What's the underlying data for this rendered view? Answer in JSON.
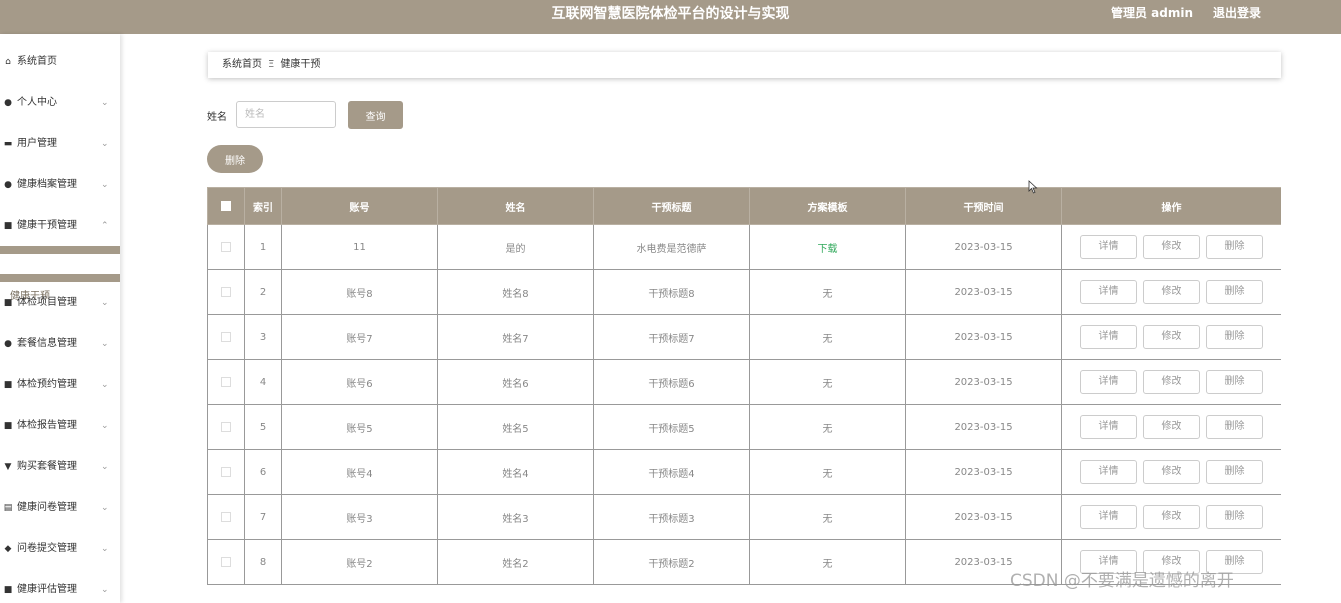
{
  "header": {
    "title": "互联网智慧医院体检平台的设计与实现",
    "admin_label": "管理员 admin",
    "logout_label": "退出登录"
  },
  "sidebar": {
    "items": [
      {
        "label": "系统首页",
        "icon": "home-icon",
        "glyph": "⌂",
        "chevron": ""
      },
      {
        "label": "个人中心",
        "icon": "person-icon",
        "glyph": "●",
        "chevron": "⌄"
      },
      {
        "label": "用户管理",
        "icon": "briefcase-icon",
        "glyph": "▬",
        "chevron": "⌄"
      },
      {
        "label": "健康档案管理",
        "icon": "person-icon",
        "glyph": "●",
        "chevron": "⌄"
      },
      {
        "label": "健康干预管理",
        "icon": "grid-icon",
        "glyph": "■",
        "chevron": "⌃"
      },
      {
        "label": "体检项目管理",
        "icon": "grid-icon",
        "glyph": "■",
        "chevron": "⌄"
      },
      {
        "label": "套餐信息管理",
        "icon": "person-icon",
        "glyph": "●",
        "chevron": "⌄"
      },
      {
        "label": "体检预约管理",
        "icon": "grid-icon",
        "glyph": "■",
        "chevron": "⌄"
      },
      {
        "label": "体检报告管理",
        "icon": "grid-icon",
        "glyph": "■",
        "chevron": "⌄"
      },
      {
        "label": "购买套餐管理",
        "icon": "ticket-icon",
        "glyph": "▼",
        "chevron": "⌄"
      },
      {
        "label": "健康问卷管理",
        "icon": "document-icon",
        "glyph": "▤",
        "chevron": "⌄"
      },
      {
        "label": "问卷提交管理",
        "icon": "pin-icon",
        "glyph": "◆",
        "chevron": "⌄"
      },
      {
        "label": "健康评估管理",
        "icon": "grid-icon",
        "glyph": "■",
        "chevron": "⌄"
      }
    ],
    "sub_item": "健康干预"
  },
  "breadcrumb": {
    "home": "系统首页",
    "separator": "Ξ",
    "current": "健康干预"
  },
  "search": {
    "label": "姓名",
    "placeholder": "姓名",
    "value": "",
    "query_button": "查询"
  },
  "batch_delete_button": "删除",
  "table": {
    "columns": [
      "索引",
      "账号",
      "姓名",
      "干预标题",
      "方案模板",
      "干预时间",
      "操作"
    ],
    "rows": [
      {
        "index": "1",
        "account": "11",
        "name": "是的",
        "title": "水电费是范德萨",
        "template": "下载",
        "time": "2023-03-15"
      },
      {
        "index": "2",
        "account": "账号8",
        "name": "姓名8",
        "title": "干预标题8",
        "template": "无",
        "time": "2023-03-15"
      },
      {
        "index": "3",
        "account": "账号7",
        "name": "姓名7",
        "title": "干预标题7",
        "template": "无",
        "time": "2023-03-15"
      },
      {
        "index": "4",
        "account": "账号6",
        "name": "姓名6",
        "title": "干预标题6",
        "template": "无",
        "time": "2023-03-15"
      },
      {
        "index": "5",
        "account": "账号5",
        "name": "姓名5",
        "title": "干预标题5",
        "template": "无",
        "time": "2023-03-15"
      },
      {
        "index": "6",
        "account": "账号4",
        "name": "姓名4",
        "title": "干预标题4",
        "template": "无",
        "time": "2023-03-15"
      },
      {
        "index": "7",
        "account": "账号3",
        "name": "姓名3",
        "title": "干预标题3",
        "template": "无",
        "time": "2023-03-15"
      },
      {
        "index": "8",
        "account": "账号2",
        "name": "姓名2",
        "title": "干预标题2",
        "template": "无",
        "time": "2023-03-15"
      }
    ],
    "actions": {
      "detail": "详情",
      "edit": "修改",
      "delete": "删除"
    }
  },
  "watermark": "CSDN @不要满是遗憾的离开",
  "colors": {
    "accent": "#a59a89",
    "download_link": "#2fa85a"
  }
}
